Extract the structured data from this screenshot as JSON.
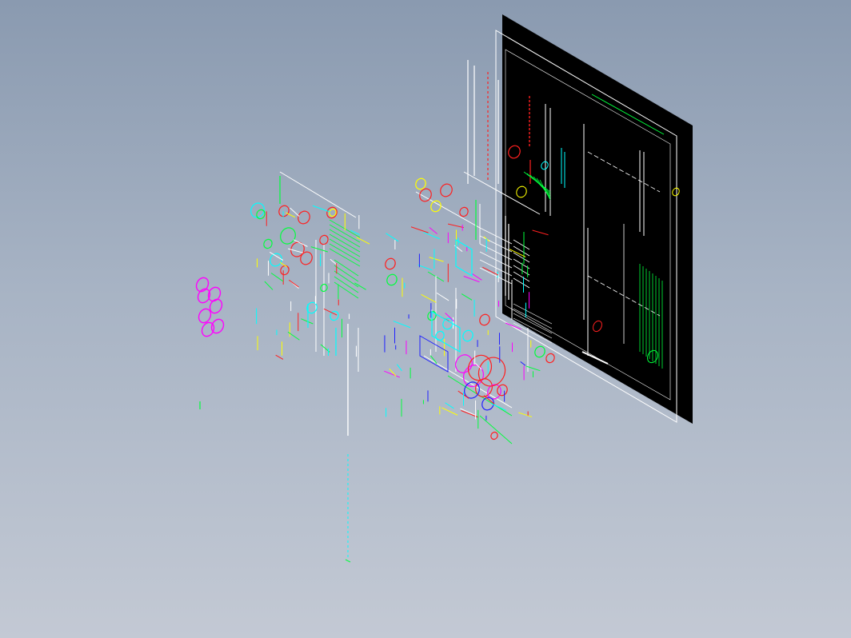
{
  "viewport": {
    "title": "",
    "colors": {
      "background_top": "#8a9ab0",
      "background_bottom": "#c3c9d4",
      "sheet": "#000000",
      "white": "#ffffff",
      "cyan": "#00ffff",
      "green": "#00ff3c",
      "red": "#ff2020",
      "yellow": "#ffff00",
      "magenta": "#ff00ff",
      "blue": "#2020ff"
    }
  },
  "scene": {
    "description_tag": "isometric-cad-drawing-view",
    "groups": [
      "drawing-sheet",
      "left-assembly",
      "center-assembly",
      "magenta-gears",
      "vertical-dimension-chain"
    ]
  }
}
